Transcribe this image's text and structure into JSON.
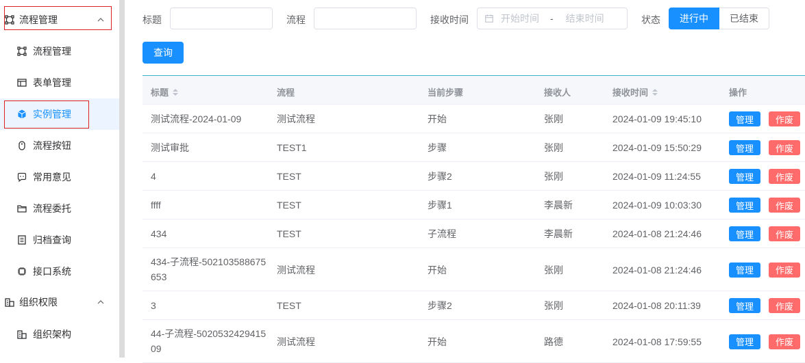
{
  "sidebar": {
    "groups": [
      {
        "label": "流程管理",
        "icon": "workflow-icon"
      },
      {
        "label": "组织权限",
        "icon": "organization-icon"
      }
    ],
    "items": [
      {
        "label": "流程管理",
        "icon": "workflow-icon"
      },
      {
        "label": "表单管理",
        "icon": "form-icon"
      },
      {
        "label": "实例管理",
        "icon": "cube-icon"
      },
      {
        "label": "流程按钮",
        "icon": "mouse-icon"
      },
      {
        "label": "常用意见",
        "icon": "comment-icon"
      },
      {
        "label": "流程委托",
        "icon": "folder-icon"
      },
      {
        "label": "归档查询",
        "icon": "archive-icon"
      },
      {
        "label": "接口系统",
        "icon": "chip-icon"
      },
      {
        "label": "组织架构",
        "icon": "organization-icon"
      }
    ],
    "active_color": "#1890ff"
  },
  "filters": {
    "title_label": "标题",
    "flow_label": "流程",
    "time_label": "接收时间",
    "start_placeholder": "开始时间",
    "range_separator": "-",
    "end_placeholder": "结束时间",
    "status_label": "状态",
    "status_options": [
      "进行中",
      "已结束"
    ],
    "status_selected": "进行中",
    "query_button": "查询"
  },
  "table": {
    "columns": [
      "标题",
      "流程",
      "当前步骤",
      "接收人",
      "接收时间",
      "操作"
    ],
    "sortable_columns": [
      "标题",
      "接收时间"
    ],
    "rows": [
      {
        "title": "测试流程-2024-01-09",
        "flow": "测试流程",
        "step": "开始",
        "receiver": "张刚",
        "time": "2024-01-09 19:45:10"
      },
      {
        "title": "测试审批",
        "flow": "TEST1",
        "step": "步骤",
        "receiver": "张刚",
        "time": "2024-01-09 15:50:29"
      },
      {
        "title": "4",
        "flow": "TEST",
        "step": "步骤2",
        "receiver": "张刚",
        "time": "2024-01-09 11:24:55"
      },
      {
        "title": "ffff",
        "flow": "TEST",
        "step": "步骤1",
        "receiver": "李晨新",
        "time": "2024-01-09 10:03:30"
      },
      {
        "title": "434",
        "flow": "TEST",
        "step": "子流程",
        "receiver": "李晨新",
        "time": "2024-01-08 21:24:46"
      },
      {
        "title": "434-子流程-502103588675653",
        "flow": "测试流程",
        "step": "开始",
        "receiver": "张刚",
        "time": "2024-01-08 21:24:46"
      },
      {
        "title": "3",
        "flow": "TEST",
        "step": "步骤2",
        "receiver": "张刚",
        "time": "2024-01-08 20:11:39"
      },
      {
        "title": "44-子流程-502053242941509",
        "flow": "测试流程",
        "step": "开始",
        "receiver": "路德",
        "time": "2024-01-08 17:59:55"
      }
    ],
    "actions": [
      "管理",
      "作废"
    ],
    "manage_color": "#1890ff",
    "void_color": "#ff6b6b"
  }
}
